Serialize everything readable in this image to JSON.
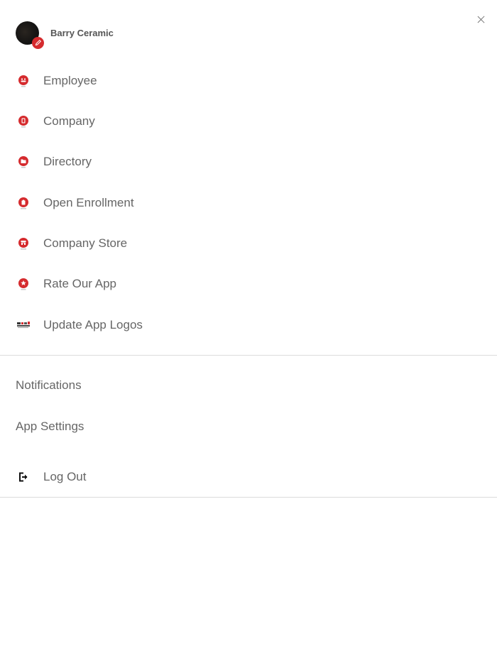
{
  "profile": {
    "name": "Barry Ceramic"
  },
  "menu": {
    "items": [
      {
        "label": "Employee",
        "icon": "employee-icon"
      },
      {
        "label": "Company",
        "icon": "company-icon"
      },
      {
        "label": "Directory",
        "icon": "directory-icon"
      },
      {
        "label": "Open Enrollment",
        "icon": "open-enrollment-icon"
      },
      {
        "label": "Company Store",
        "icon": "company-store-icon"
      },
      {
        "label": "Rate Our App",
        "icon": "star-icon"
      },
      {
        "label": "Update App Logos",
        "icon": "logo-update-icon"
      }
    ]
  },
  "secondary": {
    "notifications": "Notifications",
    "app_settings": "App Settings",
    "logout": "Log Out"
  },
  "colors": {
    "accent": "#d52b2e",
    "text": "#666666",
    "divider": "#dcdcdc"
  }
}
